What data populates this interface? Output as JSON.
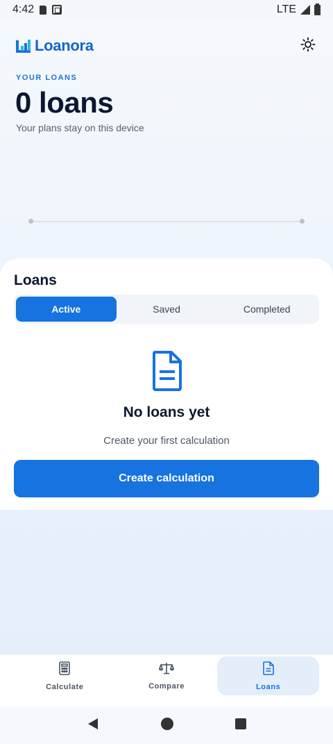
{
  "status_bar": {
    "time": "4:42",
    "network": "LTE"
  },
  "app": {
    "name": "Loanora",
    "brand_color": "#1673e0"
  },
  "icons": {
    "theme": "sun-icon",
    "empty_state": "document-icon",
    "calculate": "calculator-icon",
    "compare": "scale-icon",
    "loans": "document-icon"
  },
  "hero": {
    "label": "YOUR LOANS",
    "count": "0 loans",
    "subtitle": "Your plans stay on this device"
  },
  "loans": {
    "title": "Loans",
    "tabs": [
      {
        "label": "Active",
        "active": true
      },
      {
        "label": "Saved",
        "active": false
      },
      {
        "label": "Completed",
        "active": false
      }
    ],
    "empty_title": "No loans yet",
    "empty_subtitle": "Create your first calculation",
    "cta_label": "Create calculation"
  },
  "bottom_nav": [
    {
      "label": "Calculate",
      "active": false
    },
    {
      "label": "Compare",
      "active": false
    },
    {
      "label": "Loans",
      "active": true
    }
  ]
}
